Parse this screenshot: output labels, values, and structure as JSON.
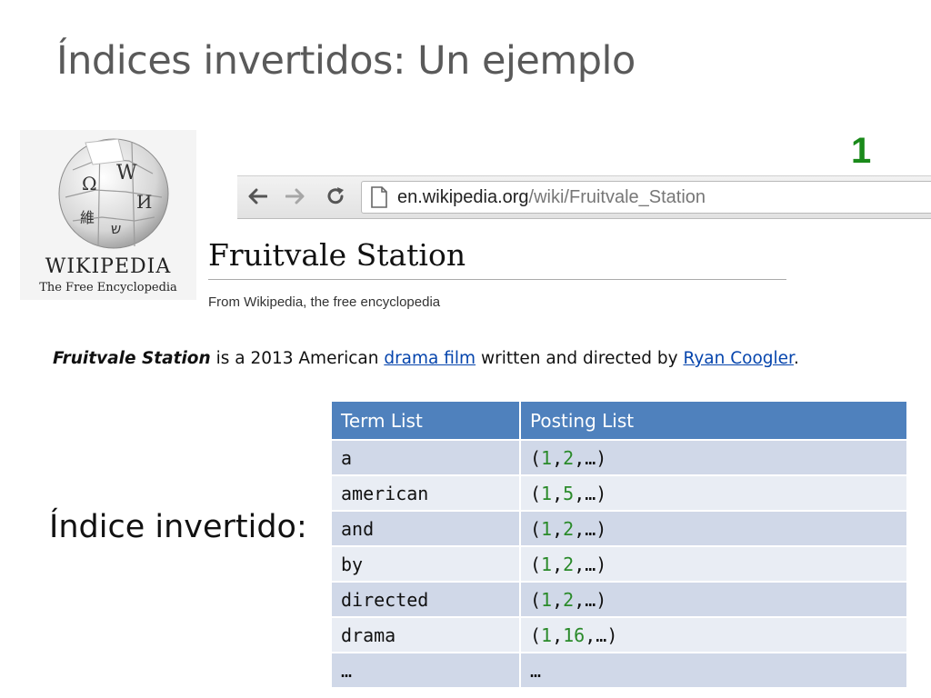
{
  "slide": {
    "title": "Índices invertidos: Un ejemplo",
    "doc_id": "1",
    "index_label": "Índice invertido:"
  },
  "logo": {
    "name": "WIKIPEDIA",
    "tagline": "The Free Encyclopedia",
    "globe_glyphs": [
      "Ω",
      "W",
      "И",
      "維",
      "ש"
    ]
  },
  "browser": {
    "url_host": "en.wikipedia.org",
    "url_path": "/wiki/Fruitvale_Station",
    "icons": [
      "back-arrow-icon",
      "forward-arrow-icon",
      "reload-icon",
      "page-icon"
    ]
  },
  "article": {
    "title": "Fruitvale Station",
    "tagline": "From Wikipedia, the free encyclopedia",
    "sentence": {
      "subject": "Fruitvale Station",
      "part1": " is a 2013 American ",
      "link1": "drama film",
      "part2": " written and directed by ",
      "link2": "Ryan Coogler",
      "end": "."
    }
  },
  "index_table": {
    "headers": [
      "Term List",
      "Posting List"
    ],
    "rows": [
      {
        "term": "a",
        "posting": [
          "(",
          "1",
          ",",
          "2",
          ",…)"
        ]
      },
      {
        "term": "american",
        "posting": [
          "(",
          "1",
          ",",
          "5",
          ",…)"
        ]
      },
      {
        "term": "and",
        "posting": [
          "(",
          "1",
          ",",
          "2",
          ",…)"
        ]
      },
      {
        "term": "by",
        "posting": [
          "(",
          "1",
          ",",
          "2",
          ",…)"
        ]
      },
      {
        "term": "directed",
        "posting": [
          "(",
          "1",
          ",",
          "2",
          ",…)"
        ]
      },
      {
        "term": "drama",
        "posting": [
          "(",
          "1",
          ",",
          "16",
          ",…)"
        ]
      },
      {
        "term": "…",
        "posting": [
          "…",
          "",
          "",
          "",
          ""
        ]
      }
    ]
  },
  "colors": {
    "header_bg": "#4f81bd",
    "row_dark": "#d0d8e8",
    "row_light": "#e9edf4",
    "doc_id": "#1a8a1a",
    "posting_numbers": "#2a8a2a",
    "link": "#0645ad"
  }
}
